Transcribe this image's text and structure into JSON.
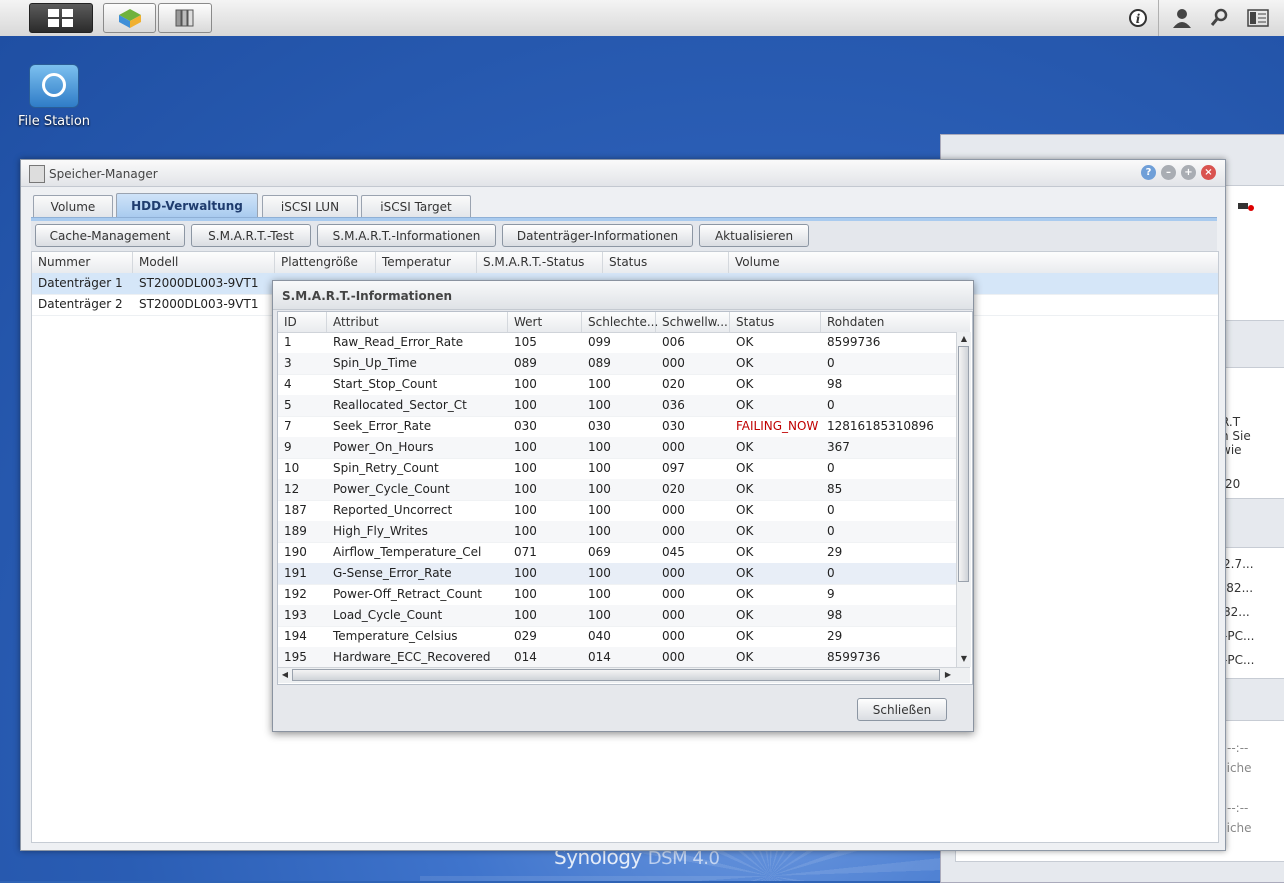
{
  "taskbar": {
    "icons": [
      "main-menu-icon",
      "package-icon",
      "storage-manager-icon"
    ],
    "right_icons": [
      "info-icon",
      "user-icon",
      "search-icon",
      "widgets-icon"
    ]
  },
  "desktop": {
    "icon_label": "File Station",
    "brand": "Synology",
    "brand_version": "DSM 4.0"
  },
  "right_panel": {
    "snippets": [
      "R.T",
      "n Sie",
      "wie",
      ":20",
      "2.7...",
      "'82...",
      "82...",
      "-PC...",
      "-PC...",
      "--:--",
      "Siche",
      "--:--",
      "Siche"
    ]
  },
  "window": {
    "title": "Speicher-Manager",
    "tabs": [
      {
        "label": "Volume"
      },
      {
        "label": "HDD-Verwaltung"
      },
      {
        "label": "iSCSI LUN"
      },
      {
        "label": "iSCSI Target"
      }
    ],
    "toolbar": [
      {
        "label": "Cache-Management"
      },
      {
        "label": "S.M.A.R.T.-Test"
      },
      {
        "label": "S.M.A.R.T.-Informationen"
      },
      {
        "label": "Datenträger-Informationen"
      },
      {
        "label": "Aktualisieren"
      }
    ],
    "columns": [
      "Nummer",
      "Modell",
      "Plattengröße",
      "Temperatur",
      "S.M.A.R.T.-Status",
      "Status",
      "Volume"
    ],
    "rows": [
      {
        "nummer": "Datenträger 1",
        "modell": "ST2000DL003-9VT1"
      },
      {
        "nummer": "Datenträger 2",
        "modell": "ST2000DL003-9VT1"
      }
    ]
  },
  "dialog": {
    "title": "S.M.A.R.T.-Informationen",
    "columns": [
      "ID",
      "Attribut",
      "Wert",
      "Schlechte...",
      "Schwellw...",
      "Status",
      "Rohdaten"
    ],
    "rows": [
      {
        "id": "1",
        "attr": "Raw_Read_Error_Rate",
        "wert": "105",
        "schlecht": "099",
        "schwell": "006",
        "status": "OK",
        "roh": "8599736"
      },
      {
        "id": "3",
        "attr": "Spin_Up_Time",
        "wert": "089",
        "schlecht": "089",
        "schwell": "000",
        "status": "OK",
        "roh": "0"
      },
      {
        "id": "4",
        "attr": "Start_Stop_Count",
        "wert": "100",
        "schlecht": "100",
        "schwell": "020",
        "status": "OK",
        "roh": "98"
      },
      {
        "id": "5",
        "attr": "Reallocated_Sector_Ct",
        "wert": "100",
        "schlecht": "100",
        "schwell": "036",
        "status": "OK",
        "roh": "0"
      },
      {
        "id": "7",
        "attr": "Seek_Error_Rate",
        "wert": "030",
        "schlecht": "030",
        "schwell": "030",
        "status": "FAILING_NOW",
        "roh": "12816185310896"
      },
      {
        "id": "9",
        "attr": "Power_On_Hours",
        "wert": "100",
        "schlecht": "100",
        "schwell": "000",
        "status": "OK",
        "roh": "367"
      },
      {
        "id": "10",
        "attr": "Spin_Retry_Count",
        "wert": "100",
        "schlecht": "100",
        "schwell": "097",
        "status": "OK",
        "roh": "0"
      },
      {
        "id": "12",
        "attr": "Power_Cycle_Count",
        "wert": "100",
        "schlecht": "100",
        "schwell": "020",
        "status": "OK",
        "roh": "85"
      },
      {
        "id": "187",
        "attr": "Reported_Uncorrect",
        "wert": "100",
        "schlecht": "100",
        "schwell": "000",
        "status": "OK",
        "roh": "0"
      },
      {
        "id": "189",
        "attr": "High_Fly_Writes",
        "wert": "100",
        "schlecht": "100",
        "schwell": "000",
        "status": "OK",
        "roh": "0"
      },
      {
        "id": "190",
        "attr": "Airflow_Temperature_Cel",
        "wert": "071",
        "schlecht": "069",
        "schwell": "045",
        "status": "OK",
        "roh": "29"
      },
      {
        "id": "191",
        "attr": "G-Sense_Error_Rate",
        "wert": "100",
        "schlecht": "100",
        "schwell": "000",
        "status": "OK",
        "roh": "0"
      },
      {
        "id": "192",
        "attr": "Power-Off_Retract_Count",
        "wert": "100",
        "schlecht": "100",
        "schwell": "000",
        "status": "OK",
        "roh": "9"
      },
      {
        "id": "193",
        "attr": "Load_Cycle_Count",
        "wert": "100",
        "schlecht": "100",
        "schwell": "000",
        "status": "OK",
        "roh": "98"
      },
      {
        "id": "194",
        "attr": "Temperature_Celsius",
        "wert": "029",
        "schlecht": "040",
        "schwell": "000",
        "status": "OK",
        "roh": "29"
      },
      {
        "id": "195",
        "attr": "Hardware_ECC_Recovered",
        "wert": "014",
        "schlecht": "014",
        "schwell": "000",
        "status": "OK",
        "roh": "8599736"
      }
    ],
    "close_label": "Schließen"
  },
  "colors": {
    "accent": "#a9cbef",
    "failing": "#c00000",
    "desktop": "#2a5db4"
  }
}
